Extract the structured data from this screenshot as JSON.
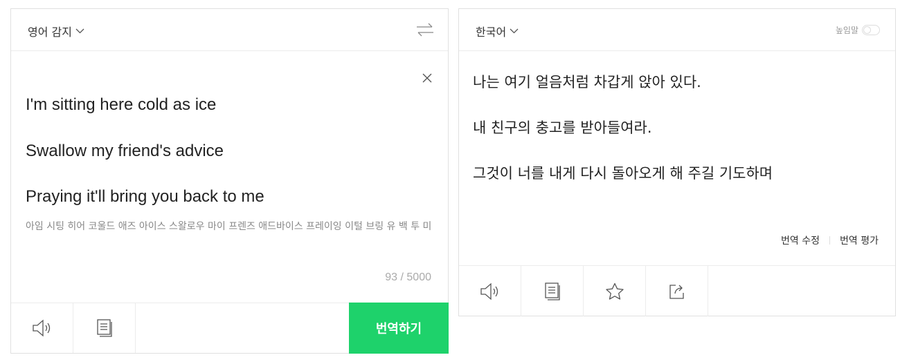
{
  "source": {
    "language_label": "영어 감지",
    "lines": [
      "I'm sitting here cold as ice",
      "Swallow my friend's advice",
      "Praying it'll bring you back to me"
    ],
    "pronunciation": "아임 시팅 히어 코울드 애즈 아이스 스왈로우 마이 프렌즈 애드바이스 프레이잉 이털 브링 유 백 투 미",
    "char_count": "93 / 5000",
    "translate_button": "번역하기"
  },
  "target": {
    "language_label": "한국어",
    "honorific_label": "높임말",
    "honorific_enabled": false,
    "lines": [
      "나는 여기 얼음처럼 차갑게 앉아 있다.",
      "내 친구의 충고를 받아들여라.",
      "그것이 너를 내게 다시 돌아오게 해 주길 기도하며"
    ],
    "edit_translation": "번역 수정",
    "rate_translation": "번역 평가"
  },
  "colors": {
    "accent": "#1ed26b",
    "border": "#e0e0e0",
    "muted_text": "#888888"
  },
  "icons": {
    "source_toolbar": [
      "speaker-icon",
      "dictionary-icon"
    ],
    "target_toolbar": [
      "speaker-icon",
      "dictionary-icon",
      "star-icon",
      "share-icon"
    ]
  }
}
